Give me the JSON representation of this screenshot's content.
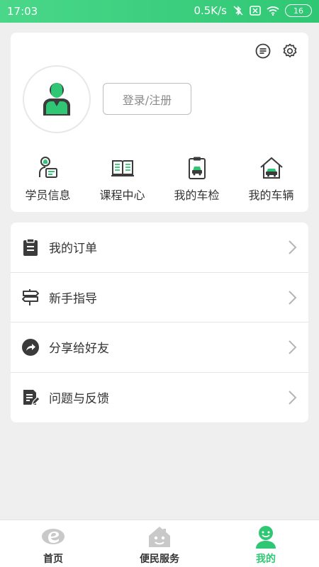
{
  "status_bar": {
    "time": "17:03",
    "speed": "0.5K/s",
    "battery": "16"
  },
  "profile": {
    "login_label": "登录/注册"
  },
  "quick_nav": [
    {
      "label": "学员信息",
      "icon": "student-info-icon"
    },
    {
      "label": "课程中心",
      "icon": "book-icon"
    },
    {
      "label": "我的车检",
      "icon": "car-inspection-icon"
    },
    {
      "label": "我的车辆",
      "icon": "garage-car-icon"
    }
  ],
  "menu": [
    {
      "label": "我的订单",
      "icon": "clipboard-icon"
    },
    {
      "label": "新手指导",
      "icon": "signpost-icon"
    },
    {
      "label": "分享给好友",
      "icon": "share-icon"
    },
    {
      "label": "问题与反馈",
      "icon": "feedback-icon"
    }
  ],
  "tabs": [
    {
      "label": "首页",
      "icon": "home-e-icon"
    },
    {
      "label": "便民服务",
      "icon": "service-house-icon"
    },
    {
      "label": "我的",
      "icon": "profile-icon",
      "active": true
    }
  ],
  "colors": {
    "accent": "#2fc774",
    "icon_dark": "#3b3b3b"
  }
}
